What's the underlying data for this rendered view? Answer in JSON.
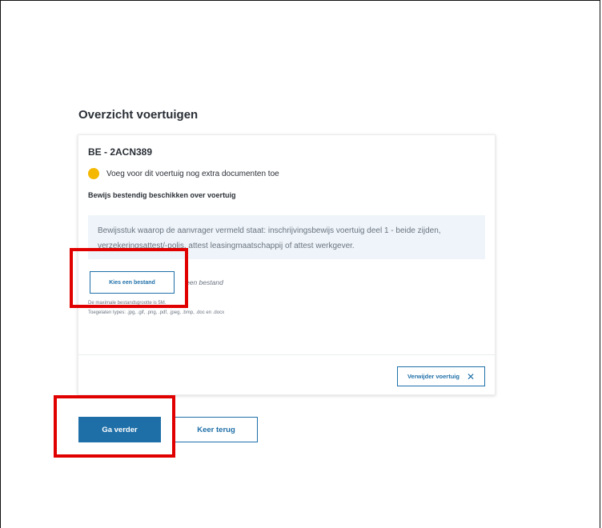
{
  "page": {
    "title": "Overzicht voertuigen"
  },
  "vehicle": {
    "plate": "BE - 2ACN389",
    "status_text": "Voeg voor dit voertuig nog extra documenten toe",
    "status_color": "#f5b800",
    "document_heading": "Bewijs bestendig beschikken over voertuig",
    "document_info_line1": "Bewijsstuk waarop de aanvrager vermeld staat: inschrijvingsbewijs voertuig deel 1 - beide zijden,",
    "document_info_line2": "verzekeringsattest/-polis, attest leasingmaatschappij of attest werkgever.",
    "choose_file_label": "Kies een bestand",
    "no_file_text": "een bestand",
    "max_size_text": "De maximale bestandsgrootte is 5M.",
    "allowed_types_text": "Toegelaten types: .jpg, .gif, .png, .pdf, .jpeg, .bmp, .doc en .docx",
    "remove_label": "Verwijder voertuig",
    "remove_icon": "close-icon"
  },
  "actions": {
    "continue_label": "Ga verder",
    "back_label": "Keer terug"
  },
  "colors": {
    "primary": "#1e6fa8",
    "highlight": "#e00000",
    "info_background": "#eef4f9"
  }
}
